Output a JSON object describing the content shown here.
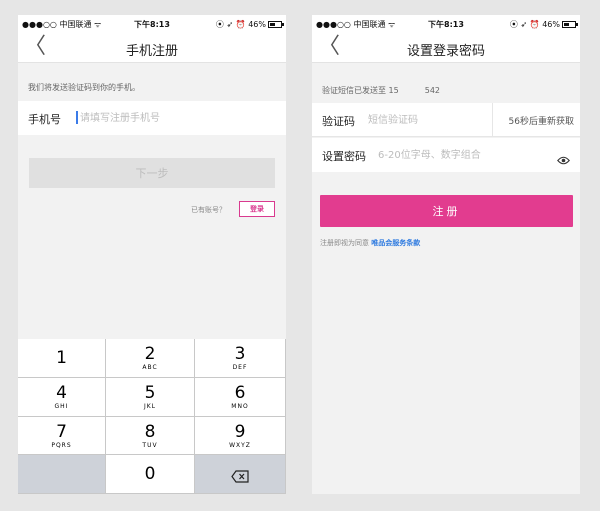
{
  "status_bar": {
    "signal": "●●●○○",
    "carrier": "中国联通",
    "time": "下午8:13",
    "icons": "⦿ ➶ ⏰",
    "battery_text": "46%",
    "battery_level": 0.46
  },
  "left_screen": {
    "back_label": "〈",
    "title": "手机注册",
    "hint": "我们将发送验证码到你的手机。",
    "phone_label": "手机号",
    "phone_placeholder": "请填写注册手机号",
    "next_button": "下一步",
    "have_account": "已有账号？",
    "login_button": "登录",
    "keypad": [
      {
        "num": "1",
        "letters": ""
      },
      {
        "num": "2",
        "letters": "ABC"
      },
      {
        "num": "3",
        "letters": "DEF"
      },
      {
        "num": "4",
        "letters": "GHI"
      },
      {
        "num": "5",
        "letters": "JKL"
      },
      {
        "num": "6",
        "letters": "MNO"
      },
      {
        "num": "7",
        "letters": "PQRS"
      },
      {
        "num": "8",
        "letters": "TUV"
      },
      {
        "num": "9",
        "letters": "WXYZ"
      },
      {
        "num": "0",
        "letters": ""
      }
    ],
    "delete_icon": "backspace-icon"
  },
  "right_screen": {
    "back_label": "〈",
    "title": "设置登录密码",
    "sent_prefix": "验证短信已发送至 15",
    "sent_suffix": "542",
    "code_label": "验证码",
    "code_placeholder": "短信验证码",
    "resend": "56秒后重新获取",
    "password_label": "设置密码",
    "password_placeholder": "6-20位字母、数字组合",
    "eye_icon": "eye-icon",
    "register_button": "注册",
    "agree_text": "注册即视为同意",
    "agree_link": "唯品会服务条款",
    "accent": "#e23c8f",
    "link_color": "#2f7be0"
  }
}
